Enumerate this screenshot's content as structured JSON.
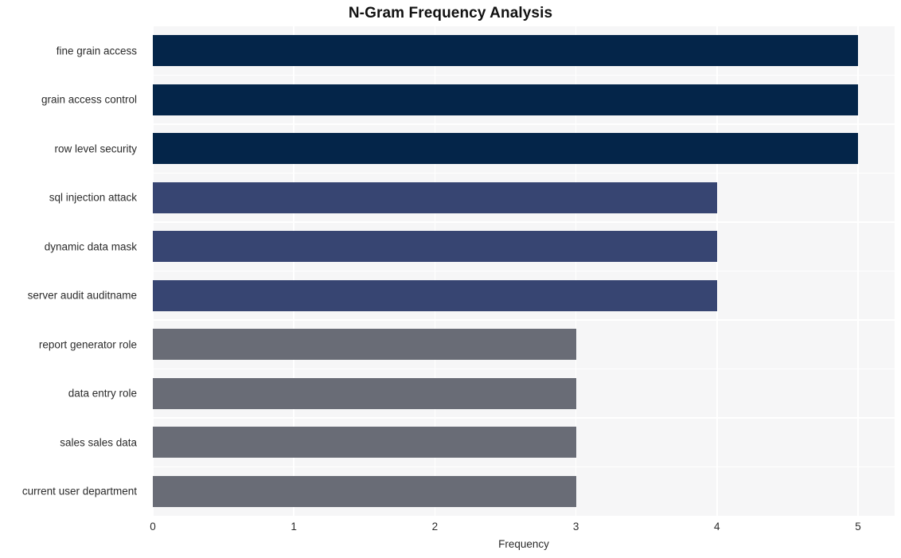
{
  "chart_data": {
    "type": "bar",
    "orientation": "horizontal",
    "title": "N-Gram Frequency Analysis",
    "xlabel": "Frequency",
    "ylabel": "",
    "categories": [
      "fine grain access",
      "grain access control",
      "row level security",
      "sql injection attack",
      "dynamic data mask",
      "server audit auditname",
      "report generator role",
      "data entry role",
      "sales sales data",
      "current user department"
    ],
    "values": [
      5,
      5,
      5,
      4,
      4,
      4,
      3,
      3,
      3,
      3
    ],
    "bar_colors": [
      "#042549",
      "#042549",
      "#042549",
      "#374572",
      "#374572",
      "#374572",
      "#696c76",
      "#696c76",
      "#696c76",
      "#696c76"
    ],
    "xlim": [
      0,
      5
    ],
    "xticks": [
      "0",
      "1",
      "2",
      "3",
      "4",
      "5"
    ],
    "xtick_values": [
      0,
      1,
      2,
      3,
      4,
      5
    ],
    "grid": true,
    "grid_color": "#ffffff",
    "plot_background": "#f6f6f7",
    "figure_background": "#ffffff",
    "legend": null,
    "legend_position": "none",
    "title_color": "#111111",
    "tick_label_color": "#2b2b2b"
  }
}
